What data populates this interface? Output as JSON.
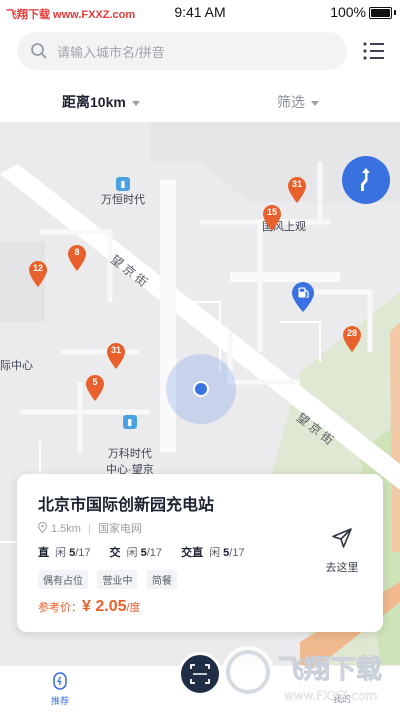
{
  "watermark": {
    "text": "飞翔下载 www.FXXZ.com",
    "logo_text": "飞翔下载",
    "logo_url": "www.FXXZ.com"
  },
  "status_bar": {
    "time": "9:41 AM",
    "battery": "100%"
  },
  "search": {
    "placeholder": "请输入城市名/拼音",
    "value": ""
  },
  "filters": {
    "distance_label": "距离10km",
    "screen_label": "筛选"
  },
  "map": {
    "pois": [
      {
        "label": "万恒时代"
      },
      {
        "label": "国风上观"
      },
      {
        "label": "际中心"
      },
      {
        "label": "万科时代\n中心·望京"
      }
    ],
    "streets": [
      {
        "label": "望 京 街"
      },
      {
        "label": "望 京 街"
      }
    ],
    "station_pins": [
      {
        "count": "31"
      },
      {
        "count": "15"
      },
      {
        "count": "8"
      },
      {
        "count": "12"
      },
      {
        "count": "31"
      },
      {
        "count": "5"
      },
      {
        "count": "28"
      }
    ],
    "colors": {
      "pin": "#e8612c",
      "gas": "#3a71e0",
      "accent": "#3a71e0"
    }
  },
  "station_card": {
    "title": "北京市国际创新园充电站",
    "distance": "1.5km",
    "operator": "国家电网",
    "chargers": [
      {
        "type": "直",
        "status": "闲",
        "available": "5",
        "total": "/17"
      },
      {
        "type": "交",
        "status": "闲",
        "available": "5",
        "total": "/17"
      },
      {
        "type": "交直",
        "status": "闲",
        "available": "5",
        "total": "/17"
      }
    ],
    "tags": [
      "偶有占位",
      "营业中",
      "简餐"
    ],
    "price_label": "参考价：",
    "price_value": "¥ 2.05",
    "price_unit": "/度",
    "goto_label": "去这里"
  },
  "tab_bar": {
    "recommend": "推荐",
    "mine": "我的"
  }
}
